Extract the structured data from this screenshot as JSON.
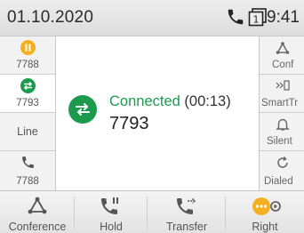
{
  "status_bar": {
    "date": "01.10.2020",
    "time": "9:41",
    "line_count": "1"
  },
  "left_keys": [
    {
      "label": "7788",
      "icon": "hold-icon",
      "color": "#f2b01e"
    },
    {
      "label": "7793",
      "icon": "transfer-icon",
      "color": "#1c9a4e"
    },
    {
      "label": "Line"
    },
    {
      "label": "7788",
      "icon": "phone-icon"
    }
  ],
  "call": {
    "status": "Connected",
    "duration": "(00:13)",
    "number": "7793",
    "status_color": "#1c9a4e"
  },
  "right_keys": [
    {
      "label": "Conf",
      "icon": "conference-icon"
    },
    {
      "label": "SmartTr",
      "icon": "smart-transfer-icon"
    },
    {
      "label": "Silent",
      "icon": "bell-icon"
    },
    {
      "label": "Dialed",
      "icon": "redial-icon"
    }
  ],
  "softkeys": [
    {
      "label": "Conference",
      "icon": "conference-icon"
    },
    {
      "label": "Hold",
      "icon": "hold-phone-icon"
    },
    {
      "label": "Transfer",
      "icon": "transfer-phone-icon"
    },
    {
      "label": "Right",
      "icon": "more-icon",
      "color": "#f2b01e"
    }
  ]
}
